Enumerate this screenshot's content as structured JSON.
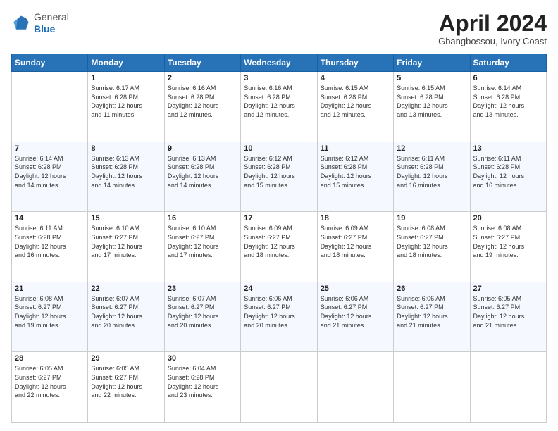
{
  "header": {
    "logo_line1": "General",
    "logo_line2": "Blue",
    "month_title": "April 2024",
    "location": "Gbangbossou, Ivory Coast"
  },
  "days_of_week": [
    "Sunday",
    "Monday",
    "Tuesday",
    "Wednesday",
    "Thursday",
    "Friday",
    "Saturday"
  ],
  "weeks": [
    [
      {
        "day": "",
        "detail": ""
      },
      {
        "day": "1",
        "detail": "Sunrise: 6:17 AM\nSunset: 6:28 PM\nDaylight: 12 hours\nand 11 minutes."
      },
      {
        "day": "2",
        "detail": "Sunrise: 6:16 AM\nSunset: 6:28 PM\nDaylight: 12 hours\nand 12 minutes."
      },
      {
        "day": "3",
        "detail": "Sunrise: 6:16 AM\nSunset: 6:28 PM\nDaylight: 12 hours\nand 12 minutes."
      },
      {
        "day": "4",
        "detail": "Sunrise: 6:15 AM\nSunset: 6:28 PM\nDaylight: 12 hours\nand 12 minutes."
      },
      {
        "day": "5",
        "detail": "Sunrise: 6:15 AM\nSunset: 6:28 PM\nDaylight: 12 hours\nand 13 minutes."
      },
      {
        "day": "6",
        "detail": "Sunrise: 6:14 AM\nSunset: 6:28 PM\nDaylight: 12 hours\nand 13 minutes."
      }
    ],
    [
      {
        "day": "7",
        "detail": "Sunrise: 6:14 AM\nSunset: 6:28 PM\nDaylight: 12 hours\nand 14 minutes."
      },
      {
        "day": "8",
        "detail": "Sunrise: 6:13 AM\nSunset: 6:28 PM\nDaylight: 12 hours\nand 14 minutes."
      },
      {
        "day": "9",
        "detail": "Sunrise: 6:13 AM\nSunset: 6:28 PM\nDaylight: 12 hours\nand 14 minutes."
      },
      {
        "day": "10",
        "detail": "Sunrise: 6:12 AM\nSunset: 6:28 PM\nDaylight: 12 hours\nand 15 minutes."
      },
      {
        "day": "11",
        "detail": "Sunrise: 6:12 AM\nSunset: 6:28 PM\nDaylight: 12 hours\nand 15 minutes."
      },
      {
        "day": "12",
        "detail": "Sunrise: 6:11 AM\nSunset: 6:28 PM\nDaylight: 12 hours\nand 16 minutes."
      },
      {
        "day": "13",
        "detail": "Sunrise: 6:11 AM\nSunset: 6:28 PM\nDaylight: 12 hours\nand 16 minutes."
      }
    ],
    [
      {
        "day": "14",
        "detail": "Sunrise: 6:11 AM\nSunset: 6:28 PM\nDaylight: 12 hours\nand 16 minutes."
      },
      {
        "day": "15",
        "detail": "Sunrise: 6:10 AM\nSunset: 6:27 PM\nDaylight: 12 hours\nand 17 minutes."
      },
      {
        "day": "16",
        "detail": "Sunrise: 6:10 AM\nSunset: 6:27 PM\nDaylight: 12 hours\nand 17 minutes."
      },
      {
        "day": "17",
        "detail": "Sunrise: 6:09 AM\nSunset: 6:27 PM\nDaylight: 12 hours\nand 18 minutes."
      },
      {
        "day": "18",
        "detail": "Sunrise: 6:09 AM\nSunset: 6:27 PM\nDaylight: 12 hours\nand 18 minutes."
      },
      {
        "day": "19",
        "detail": "Sunrise: 6:08 AM\nSunset: 6:27 PM\nDaylight: 12 hours\nand 18 minutes."
      },
      {
        "day": "20",
        "detail": "Sunrise: 6:08 AM\nSunset: 6:27 PM\nDaylight: 12 hours\nand 19 minutes."
      }
    ],
    [
      {
        "day": "21",
        "detail": "Sunrise: 6:08 AM\nSunset: 6:27 PM\nDaylight: 12 hours\nand 19 minutes."
      },
      {
        "day": "22",
        "detail": "Sunrise: 6:07 AM\nSunset: 6:27 PM\nDaylight: 12 hours\nand 20 minutes."
      },
      {
        "day": "23",
        "detail": "Sunrise: 6:07 AM\nSunset: 6:27 PM\nDaylight: 12 hours\nand 20 minutes."
      },
      {
        "day": "24",
        "detail": "Sunrise: 6:06 AM\nSunset: 6:27 PM\nDaylight: 12 hours\nand 20 minutes."
      },
      {
        "day": "25",
        "detail": "Sunrise: 6:06 AM\nSunset: 6:27 PM\nDaylight: 12 hours\nand 21 minutes."
      },
      {
        "day": "26",
        "detail": "Sunrise: 6:06 AM\nSunset: 6:27 PM\nDaylight: 12 hours\nand 21 minutes."
      },
      {
        "day": "27",
        "detail": "Sunrise: 6:05 AM\nSunset: 6:27 PM\nDaylight: 12 hours\nand 21 minutes."
      }
    ],
    [
      {
        "day": "28",
        "detail": "Sunrise: 6:05 AM\nSunset: 6:27 PM\nDaylight: 12 hours\nand 22 minutes."
      },
      {
        "day": "29",
        "detail": "Sunrise: 6:05 AM\nSunset: 6:27 PM\nDaylight: 12 hours\nand 22 minutes."
      },
      {
        "day": "30",
        "detail": "Sunrise: 6:04 AM\nSunset: 6:28 PM\nDaylight: 12 hours\nand 23 minutes."
      },
      {
        "day": "",
        "detail": ""
      },
      {
        "day": "",
        "detail": ""
      },
      {
        "day": "",
        "detail": ""
      },
      {
        "day": "",
        "detail": ""
      }
    ]
  ]
}
